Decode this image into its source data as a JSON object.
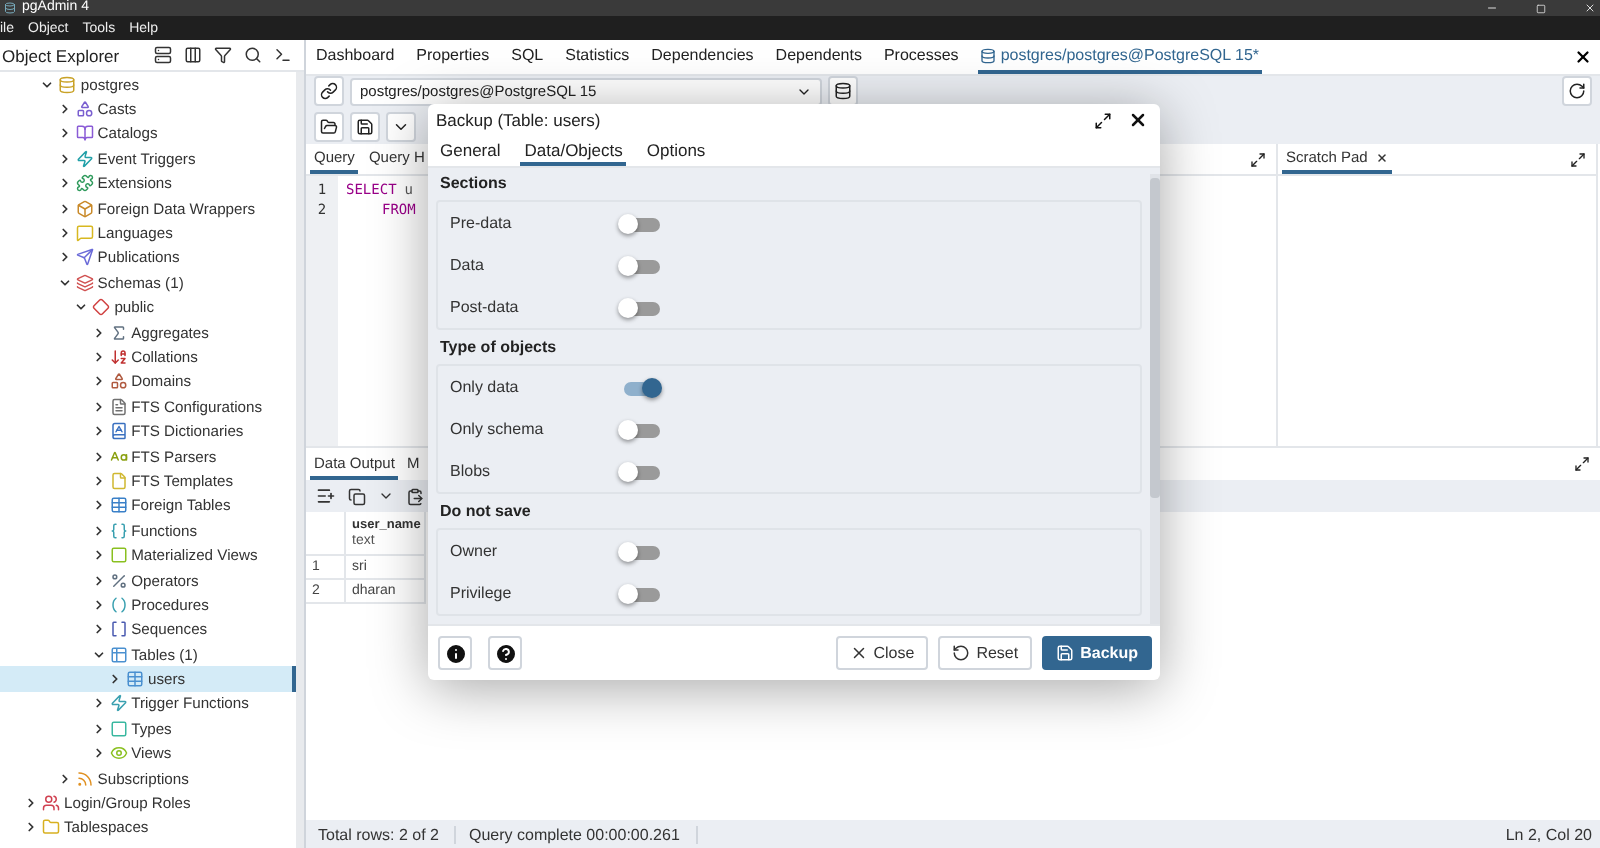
{
  "window": {
    "title": "pgAdmin 4"
  },
  "menu": [
    "ile",
    "Object",
    "Tools",
    "Help"
  ],
  "object_explorer": {
    "title": "Object Explorer",
    "tree": [
      {
        "children": [
          {
            "label": "postgres",
            "kind": "database",
            "expanded": true,
            "selected": false,
            "children": [
              {
                "label": "Casts",
                "kind": "cast",
                "expanded": false,
                "selected": false
              },
              {
                "label": "Catalogs",
                "kind": "catalog",
                "expanded": false,
                "selected": false
              },
              {
                "label": "Event Triggers",
                "kind": "event_trigger",
                "expanded": false,
                "selected": false
              },
              {
                "label": "Extensions",
                "kind": "extension",
                "expanded": false,
                "selected": false
              },
              {
                "label": "Foreign Data Wrappers",
                "kind": "fdw",
                "expanded": false,
                "selected": false
              },
              {
                "label": "Languages",
                "kind": "language",
                "expanded": false,
                "selected": false
              },
              {
                "label": "Publications",
                "kind": "publication",
                "expanded": false,
                "selected": false
              },
              {
                "label": "Schemas (1)",
                "kind": "schemas",
                "expanded": true,
                "selected": false,
                "children": [
                  {
                    "label": "public",
                    "kind": "schema",
                    "expanded": true,
                    "selected": false,
                    "children": [
                      {
                        "label": "Aggregates",
                        "kind": "aggregate",
                        "expanded": false,
                        "selected": false
                      },
                      {
                        "label": "Collations",
                        "kind": "collation",
                        "expanded": false,
                        "selected": false
                      },
                      {
                        "label": "Domains",
                        "kind": "domain",
                        "expanded": false,
                        "selected": false
                      },
                      {
                        "label": "FTS Configurations",
                        "kind": "fts_config",
                        "expanded": false,
                        "selected": false
                      },
                      {
                        "label": "FTS Dictionaries",
                        "kind": "fts_dict",
                        "expanded": false,
                        "selected": false
                      },
                      {
                        "label": "FTS Parsers",
                        "kind": "fts_parser",
                        "expanded": false,
                        "selected": false
                      },
                      {
                        "label": "FTS Templates",
                        "kind": "fts_template",
                        "expanded": false,
                        "selected": false
                      },
                      {
                        "label": "Foreign Tables",
                        "kind": "foreign_table",
                        "expanded": false,
                        "selected": false
                      },
                      {
                        "label": "Functions",
                        "kind": "function",
                        "expanded": false,
                        "selected": false
                      },
                      {
                        "label": "Materialized Views",
                        "kind": "mat_view",
                        "expanded": false,
                        "selected": false
                      },
                      {
                        "label": "Operators",
                        "kind": "operator",
                        "expanded": false,
                        "selected": false
                      },
                      {
                        "label": "Procedures",
                        "kind": "procedure",
                        "expanded": false,
                        "selected": false
                      },
                      {
                        "label": "Sequences",
                        "kind": "sequence",
                        "expanded": false,
                        "selected": false
                      },
                      {
                        "label": "Tables (1)",
                        "kind": "tables",
                        "expanded": true,
                        "selected": false,
                        "children": [
                          {
                            "label": "users",
                            "kind": "table",
                            "expanded": false,
                            "selected": true
                          }
                        ]
                      },
                      {
                        "label": "Trigger Functions",
                        "kind": "trigger_function",
                        "expanded": false,
                        "selected": false
                      },
                      {
                        "label": "Types",
                        "kind": "type",
                        "expanded": false,
                        "selected": false
                      },
                      {
                        "label": "Views",
                        "kind": "view",
                        "expanded": false,
                        "selected": false
                      }
                    ]
                  }
                ]
              },
              {
                "label": "Subscriptions",
                "kind": "subscription",
                "expanded": false,
                "selected": false
              }
            ]
          }
        ]
      },
      {
        "label": "Login/Group Roles",
        "kind": "roles",
        "expanded": false,
        "selected": false
      },
      {
        "label": "Tablespaces",
        "kind": "tablespace",
        "expanded": false,
        "selected": false
      }
    ]
  },
  "main_tabs": [
    {
      "label": "Dashboard",
      "kind": "panel",
      "selected": false
    },
    {
      "label": "Properties",
      "kind": "panel",
      "selected": false
    },
    {
      "label": "SQL",
      "kind": "panel",
      "selected": false
    },
    {
      "label": "Statistics",
      "kind": "panel",
      "selected": false
    },
    {
      "label": "Dependencies",
      "kind": "panel",
      "selected": false
    },
    {
      "label": "Dependents",
      "kind": "panel",
      "selected": false
    },
    {
      "label": "Processes",
      "kind": "panel",
      "selected": false
    },
    {
      "label": "postgres/postgres@PostgreSQL 15*",
      "kind": "query",
      "selected": true
    }
  ],
  "query_tool": {
    "connection": "postgres/postgres@PostgreSQL 15",
    "editor_tabs": [
      {
        "label": "Query",
        "selected": true
      },
      {
        "label": "Query H",
        "selected": false
      }
    ],
    "code_lines": [
      {
        "number": "1",
        "keyword": "SELECT",
        "text": "u",
        "indented": false
      },
      {
        "number": "2",
        "keyword": "FROM",
        "indented": true
      }
    ]
  },
  "scratch_pad": {
    "title": "Scratch Pad"
  },
  "output": {
    "tabs": [
      {
        "label": "Data Output",
        "selected": true
      },
      {
        "label": "M",
        "selected": false
      }
    ],
    "columns": [
      {
        "name": "user_name",
        "type": "text"
      }
    ],
    "rows": [
      {
        "number": "1",
        "cells": [
          "sri"
        ]
      },
      {
        "number": "2",
        "cells": [
          "dharan"
        ]
      }
    ]
  },
  "status_bar": {
    "rows": "Total rows: 2 of 2",
    "query": "Query complete 00:00:00.261",
    "cursor": "Ln 2, Col 20"
  },
  "dialog": {
    "title": "Backup (Table: users)",
    "tabs": [
      {
        "label": "General",
        "selected": false
      },
      {
        "label": "Data/Objects",
        "selected": true
      },
      {
        "label": "Options",
        "selected": false
      }
    ],
    "groups": [
      {
        "title": "Sections",
        "options": [
          {
            "label": "Pre-data",
            "on": false
          },
          {
            "label": "Data",
            "on": false
          },
          {
            "label": "Post-data",
            "on": false
          }
        ]
      },
      {
        "title": "Type of objects",
        "options": [
          {
            "label": "Only data",
            "on": true
          },
          {
            "label": "Only schema",
            "on": false
          },
          {
            "label": "Blobs",
            "on": false
          }
        ]
      },
      {
        "title": "Do not save",
        "options": [
          {
            "label": "Owner",
            "on": false
          },
          {
            "label": "Privilege",
            "on": false
          }
        ]
      }
    ],
    "buttons": [
      {
        "label": "Close",
        "kind": "close"
      },
      {
        "label": "Reset",
        "kind": "reset"
      },
      {
        "label": "Backup",
        "kind": "primary"
      }
    ]
  }
}
